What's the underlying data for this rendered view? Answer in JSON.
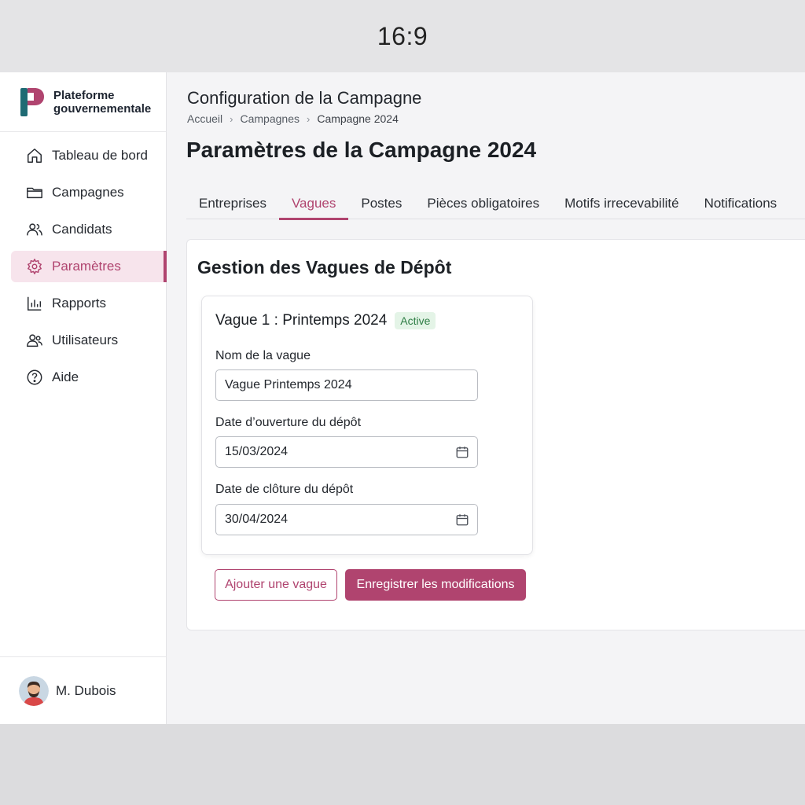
{
  "frame": {
    "aspect_label": "16:9"
  },
  "brand": {
    "line1": "Plateforme",
    "line2": "gouvernementale"
  },
  "sidebar": {
    "items": [
      {
        "label": "Tableau de bord",
        "icon": "home-icon"
      },
      {
        "label": "Campagnes",
        "icon": "folder-icon"
      },
      {
        "label": "Candidats",
        "icon": "users-icon"
      },
      {
        "label": "Paramètres",
        "icon": "gear-icon",
        "active": true
      },
      {
        "label": "Rapports",
        "icon": "bar-chart-icon"
      },
      {
        "label": "Utilisateurs",
        "icon": "user-group-icon"
      },
      {
        "label": "Aide",
        "icon": "help-icon"
      }
    ]
  },
  "user": {
    "name": "M. Dubois"
  },
  "header": {
    "small_title": "Configuration de la Campagne",
    "breadcrumb": [
      "Accueil",
      "Campagnes",
      "Campagne 2024"
    ],
    "title": "Paramètres de la Campagne 2024"
  },
  "tabs": [
    {
      "label": "Entreprises"
    },
    {
      "label": "Vagues",
      "active": true
    },
    {
      "label": "Postes"
    },
    {
      "label": "Pièces obligatoires"
    },
    {
      "label": "Motifs irrecevabilité"
    },
    {
      "label": "Notifications"
    }
  ],
  "panel": {
    "title": "Gestion des Vagues de Dépôt",
    "card": {
      "title": "Vague 1 : Printemps 2024",
      "badge": "Active",
      "fields": {
        "name_label": "Nom de la vague",
        "name_value": "Vague Printemps 2024",
        "open_label": "Date d’ouverture du dépôt",
        "open_value": "15/03/2024",
        "close_label": "Date de clôture du dépôt",
        "close_value": "30/04/2024"
      }
    },
    "add_button": "Ajouter une vague",
    "save_button": "Enregistrer les modifications"
  },
  "colors": {
    "accent": "#b0446f",
    "active_bg": "#f7e4ec",
    "badge_bg": "#e4f4e7",
    "badge_text": "#2e7d45"
  }
}
